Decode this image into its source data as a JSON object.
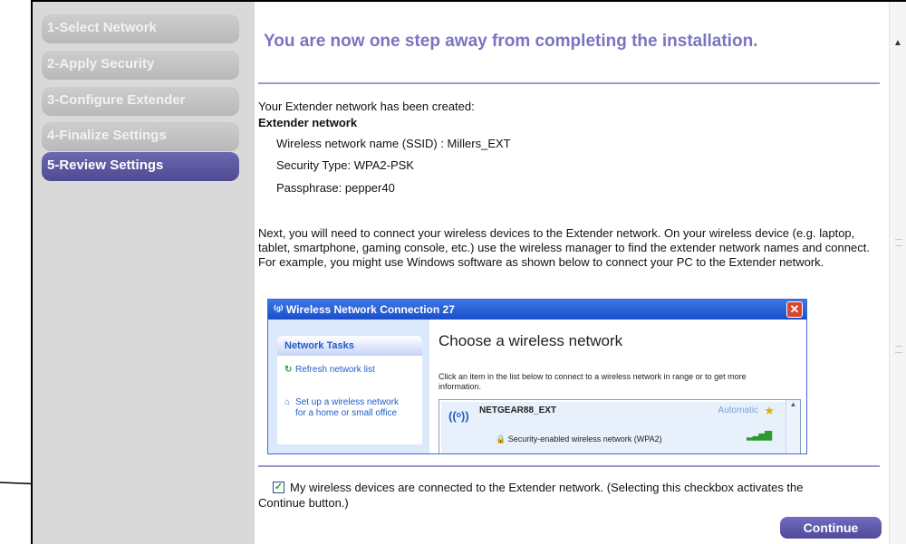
{
  "sidebar": {
    "steps": [
      {
        "label": "1-Select Network"
      },
      {
        "label": "2-Apply Security"
      },
      {
        "label": "3-Configure Extender"
      },
      {
        "label": "4-Finalize Settings"
      },
      {
        "label": "5-Review Settings"
      }
    ],
    "active_step": 5
  },
  "main": {
    "title": "You are now one step away from completing the installation.",
    "created_text": "Your Extender network has been created:",
    "network_heading": "Extender network",
    "ssid_line": "Wireless network name (SSID) : Millers_EXT",
    "security_line": "Security Type: WPA2-PSK",
    "passphrase_line": "Passphrase: pepper40",
    "instructions": "Next, you will need to connect your wireless devices to the Extender network. On your wireless device (e.g. laptop, tablet, smartphone, gaming console, etc.) use the wireless manager to find the extender network names and connect. For example, you might use Windows software as shown below to connect your PC to the Extender network.",
    "checkbox_label_line1": "My wireless devices are connected to the Extender network. (Selecting this checkbox activates the",
    "checkbox_label_line2": "Continue button.)",
    "checkbox_checked": true,
    "continue_label": "Continue"
  },
  "dialog": {
    "title": "Wireless Network Connection 27",
    "tasks_heading": "Network Tasks",
    "task_refresh": "Refresh network list",
    "task_setup_line1": "Set up a wireless network",
    "task_setup_line2": "for a home or small office",
    "heading": "Choose a wireless network",
    "description": "Click an item in the list below to connect to a wireless network in range or to get more information.",
    "network_name": "NETGEAR88_EXT",
    "connection_mode": "Automatic",
    "security_text": "Security-enabled wireless network (WPA2)"
  },
  "colors": {
    "accent": "#7a74c2",
    "active_step": "#56519a",
    "inactive_step": "#c4c4c4",
    "sidebar_bg": "#d9d9d9",
    "xp_title": "#2a62d6"
  }
}
